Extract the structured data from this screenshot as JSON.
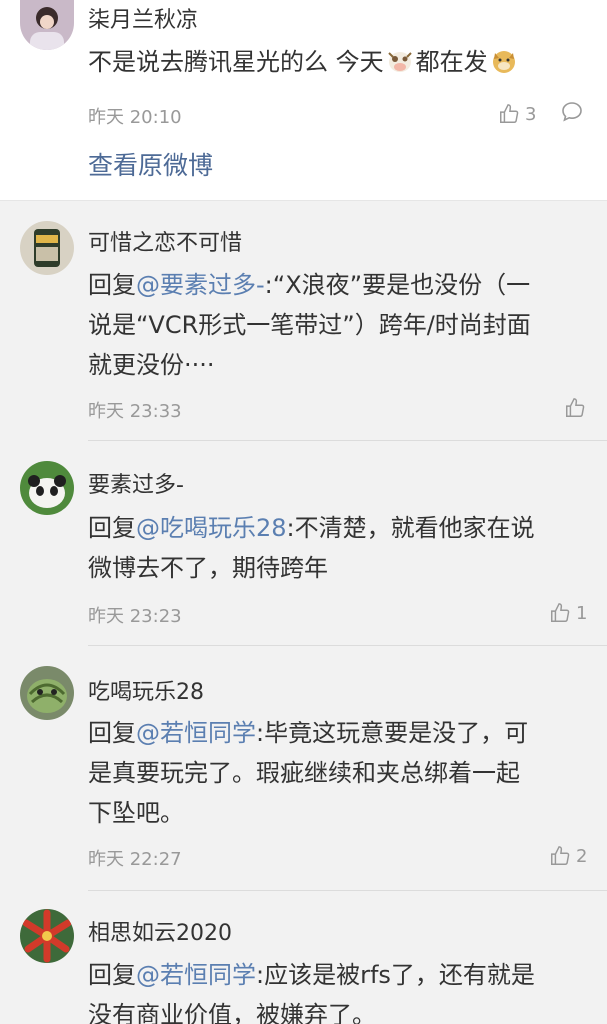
{
  "top": {
    "username": "柒月兰秋凉",
    "text_before": "不是说去腾讯星光的么 今天",
    "text_middle": "都在发",
    "time": "昨天 20:10",
    "likes": "3",
    "view_original": "查看原微博"
  },
  "replies": [
    {
      "username": "可惜之恋不可惜",
      "prefix": "回复",
      "mention": "@要素过多-",
      "line1": ":“X浪夜”要是也没份（一",
      "line2": "说是“VCR形式一笔带过”）跨年/时尚封面",
      "line3": "就更没份····",
      "time": "昨天 23:33",
      "likes": ""
    },
    {
      "username": "要素过多-",
      "prefix": "回复",
      "mention": "@吃喝玩乐28",
      "line1": ":不清楚，就看他家在说",
      "line2": "微博去不了，期待跨年",
      "time": "昨天 23:23",
      "likes": "1"
    },
    {
      "username": "吃喝玩乐28",
      "prefix": "回复",
      "mention": "@若恒同学",
      "line1": ":毕竟这玩意要是没了，可",
      "line2": "是真要玩完了。瑕疵继续和夹总绑着一起",
      "line3": "下坠吧。",
      "time": "昨天 22:27",
      "likes": "2"
    },
    {
      "username": "相思如云2020",
      "prefix": "回复",
      "mention": "@若恒同学",
      "line1": ":应该是被rfs了，还有就是",
      "line2": "没有商业价值，被嫌弃了。"
    }
  ],
  "colors": {
    "mention": "#5b7fb1",
    "link": "#4d6a96",
    "meta": "#999999"
  },
  "icons": [
    "thumbs-up-icon",
    "comment-icon",
    "cow-emoji",
    "doge-emoji"
  ]
}
